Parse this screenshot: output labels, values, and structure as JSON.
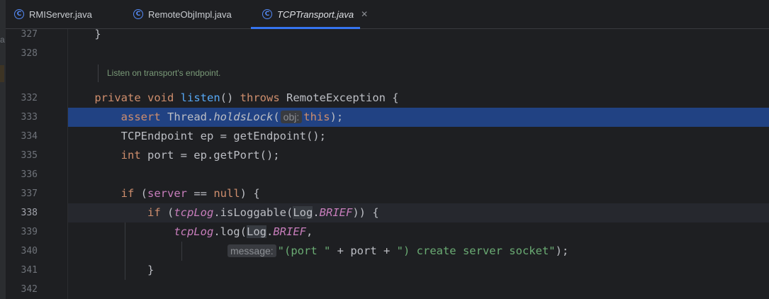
{
  "tabs": [
    {
      "label": "RMIServer.java",
      "icon": "class-c-icon",
      "active": false
    },
    {
      "label": "RemoteObjImpl.java",
      "icon": "class-c-icon",
      "active": false
    },
    {
      "label": "TCPTransport.java",
      "icon": "class-c-icon",
      "active": true
    }
  ],
  "close_glyph": "✕",
  "class_glyph": "C",
  "left_strip_char": "a",
  "doc_comment": "Listen on transport's endpoint.",
  "line_numbers": [
    "327",
    "328",
    "332",
    "333",
    "334",
    "335",
    "336",
    "337",
    "338",
    "339",
    "340",
    "341",
    "342"
  ],
  "code": {
    "l327": {
      "brace": "}"
    },
    "l332": {
      "kw1": "private",
      "kw2": "void",
      "fn": "listen",
      "p1": "() ",
      "kw3": "throws",
      "rest": " RemoteException {"
    },
    "l333": {
      "kw": "assert",
      "t1": " Thread.",
      "m": "holdsLock",
      "t2": "(",
      "hint": "obj:",
      "kw2": "this",
      "t3": ");"
    },
    "l334": {
      "t": "TCPEndpoint ep = getEndpoint();"
    },
    "l335": {
      "kw": "int",
      "t": " port = ep.getPort();"
    },
    "l337": {
      "kw": "if",
      "t1": " (",
      "f": "server",
      "t2": " == ",
      "kw2": "null",
      "t3": ") {"
    },
    "l338": {
      "kw": "if",
      "t1": " (",
      "f": "tcpLog",
      "t2": ".isLoggable(",
      "cls": "Log",
      "t3": ".",
      "f2": "BRIEF",
      "t4": ")) {"
    },
    "l339": {
      "f": "tcpLog",
      "t1": ".log(",
      "cls": "Log",
      "t2": ".",
      "f2": "BRIEF",
      "t3": ","
    },
    "l340": {
      "hint": "message:",
      "s1": "\"(port \"",
      "t1": " + port + ",
      "s2": "\") create server socket\"",
      "t2": ");"
    },
    "l341": {
      "brace": "}"
    }
  }
}
